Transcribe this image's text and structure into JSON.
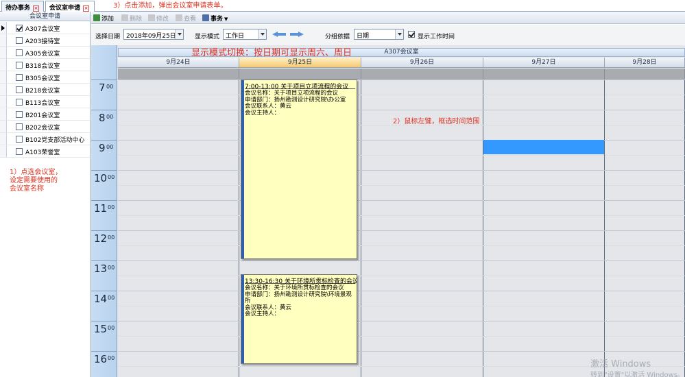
{
  "tabs": [
    {
      "label": "待办事务",
      "active": false
    },
    {
      "label": "会议室申请",
      "active": true
    }
  ],
  "annotations": {
    "step3": "3）点击添加，弹出会议室申请表单。",
    "step1": [
      "1）点选会议室，",
      "设定需要使用的",
      "会议室名称"
    ],
    "mode_hint": "显示模式切换：按日期可显示周六、周日",
    "step2": "2）鼠标左键，框选时间范围"
  },
  "left_panel": {
    "header": "会议室申请",
    "rooms": [
      {
        "name": "A307会议室",
        "checked": true,
        "current": true
      },
      {
        "name": "A203接待室",
        "checked": false
      },
      {
        "name": "A305会议室",
        "checked": false
      },
      {
        "name": "B318会议室",
        "checked": false
      },
      {
        "name": "B305会议室",
        "checked": false
      },
      {
        "name": "B218会议室",
        "checked": false
      },
      {
        "name": "B113会议室",
        "checked": false
      },
      {
        "name": "B201会议室",
        "checked": false
      },
      {
        "name": "B202会议室",
        "checked": false
      },
      {
        "name": "B102党支部活动中心",
        "checked": false
      },
      {
        "name": "A103荣誉室",
        "checked": false
      }
    ]
  },
  "toolbar": {
    "add": "添加",
    "delete": "删除",
    "edit": "修改",
    "view": "查看",
    "affairs": "事务"
  },
  "filter": {
    "date_label": "选择日期",
    "date_value": "2018年09月25日",
    "mode_label": "显示模式",
    "mode_value": "工作日",
    "group_label": "分组依据",
    "group_value": "日期",
    "show_worktime_label": "显示工作时间",
    "show_worktime_checked": true
  },
  "calendar": {
    "resource": "A307会议室",
    "days": [
      "9月24日",
      "9月25日",
      "9月26日",
      "9月27日",
      "9月28日"
    ],
    "today": "9月25日",
    "hours": [
      "7",
      "8",
      "9",
      "10",
      "11",
      "12",
      "13",
      "14",
      "15",
      "16"
    ],
    "minute_suffix": "00",
    "events": [
      {
        "title": "7:00-13:00  关于项目立项流程的会议",
        "lines": [
          "会议名称：关于项目立项流程的会议",
          "申请部门：扬州勘测设计研究院\\办公室",
          "会议联系人：黄云",
          "会议主持人："
        ]
      },
      {
        "title": "13:30-16:30  关于环境所贯标检查的会议",
        "lines": [
          "会议名称：关于环境所贯标检查的会议",
          "申请部门：扬州勘测设计研究院\\环境景观所",
          "会议联系人：黄云",
          "会议主持人："
        ]
      }
    ]
  },
  "watermark": [
    "激活 Windows",
    "转到\"设置\"以激活 Windows。"
  ]
}
